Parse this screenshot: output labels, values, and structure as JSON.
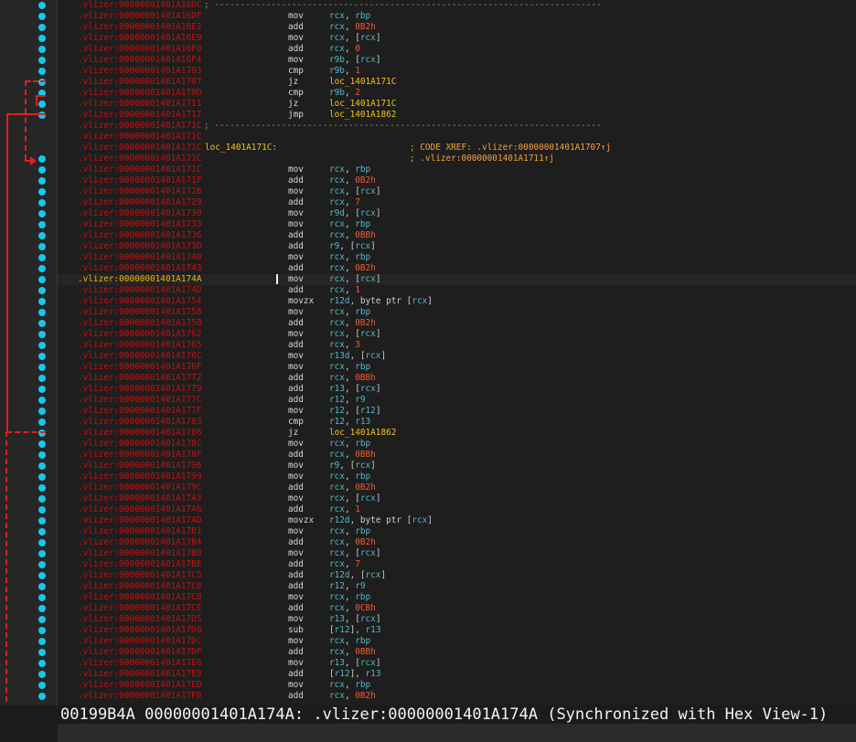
{
  "status_bar": {
    "text": "00199B4A 00000001401A174A: .vlizer:00000001401A174A (Synchronized with Hex View-1)"
  },
  "colors": {
    "background": "#1e1e1e",
    "address_red": "#c31111",
    "address_selected": "#f3b400",
    "register": "#56b7c8",
    "number": "#ef5b36",
    "label": "#f3c219",
    "comment": "#f7a23a",
    "flow_arrow": "#e0201e",
    "gutter_dot": "#18c6ee"
  },
  "listing": {
    "selected_address": ".vlizer:00000001401A174A",
    "rows": [
      {
        "addr": ".vlizer:00000001401A16DC",
        "sep": "; ---------------------------------------------------------------------------"
      },
      {
        "addr": ".vlizer:00000001401A16DF",
        "mn": "mov",
        "ops": [
          [
            "reg",
            "rcx"
          ],
          [
            "txt",
            ", "
          ],
          [
            "reg",
            "rbp"
          ]
        ]
      },
      {
        "addr": ".vlizer:00000001401A16E2",
        "mn": "add",
        "ops": [
          [
            "reg",
            "rcx"
          ],
          [
            "txt",
            ", "
          ],
          [
            "num",
            "0B2h"
          ]
        ]
      },
      {
        "addr": ".vlizer:00000001401A16E9",
        "mn": "mov",
        "ops": [
          [
            "reg",
            "rcx"
          ],
          [
            "txt",
            ", ["
          ],
          [
            "reg",
            "rcx"
          ],
          [
            "txt",
            "]"
          ]
        ]
      },
      {
        "addr": ".vlizer:00000001401A16F0",
        "mn": "add",
        "ops": [
          [
            "reg",
            "rcx"
          ],
          [
            "txt",
            ", "
          ],
          [
            "num",
            "0"
          ]
        ]
      },
      {
        "addr": ".vlizer:00000001401A16F4",
        "mn": "mov",
        "ops": [
          [
            "reg",
            "r9b"
          ],
          [
            "txt",
            ", ["
          ],
          [
            "reg",
            "rcx"
          ],
          [
            "txt",
            "]"
          ]
        ]
      },
      {
        "addr": ".vlizer:00000001401A1703",
        "mn": "cmp",
        "ops": [
          [
            "reg",
            "r9b"
          ],
          [
            "txt",
            ", "
          ],
          [
            "num",
            "1"
          ]
        ]
      },
      {
        "addr": ".vlizer:00000001401A1707",
        "mn": "jz",
        "ops": [
          [
            "loc",
            "loc_1401A171C"
          ]
        ]
      },
      {
        "addr": ".vlizer:00000001401A170D",
        "mn": "cmp",
        "ops": [
          [
            "reg",
            "r9b"
          ],
          [
            "txt",
            ", "
          ],
          [
            "num",
            "2"
          ]
        ]
      },
      {
        "addr": ".vlizer:00000001401A1711",
        "mn": "jz",
        "ops": [
          [
            "loc",
            "loc_1401A171C"
          ]
        ]
      },
      {
        "addr": ".vlizer:00000001401A1717",
        "mn": "jmp",
        "ops": [
          [
            "loc",
            "loc_1401A1862"
          ]
        ]
      },
      {
        "addr": ".vlizer:00000001401A171C",
        "sep": "; ---------------------------------------------------------------------------"
      },
      {
        "addr": ".vlizer:00000001401A171C"
      },
      {
        "addr": ".vlizer:00000001401A171C",
        "label": "loc_1401A171C:",
        "xref": "; CODE XREF: .vlizer:00000001401A1707↑j"
      },
      {
        "addr": ".vlizer:00000001401A171C",
        "xref": "; .vlizer:00000001401A1711↑j"
      },
      {
        "addr": ".vlizer:00000001401A171C",
        "mn": "mov",
        "ops": [
          [
            "reg",
            "rcx"
          ],
          [
            "txt",
            ", "
          ],
          [
            "reg",
            "rbp"
          ]
        ]
      },
      {
        "addr": ".vlizer:00000001401A171F",
        "mn": "add",
        "ops": [
          [
            "reg",
            "rcx"
          ],
          [
            "txt",
            ", "
          ],
          [
            "num",
            "0B2h"
          ]
        ]
      },
      {
        "addr": ".vlizer:00000001401A1726",
        "mn": "mov",
        "ops": [
          [
            "reg",
            "rcx"
          ],
          [
            "txt",
            ", ["
          ],
          [
            "reg",
            "rcx"
          ],
          [
            "txt",
            "]"
          ]
        ]
      },
      {
        "addr": ".vlizer:00000001401A1729",
        "mn": "add",
        "ops": [
          [
            "reg",
            "rcx"
          ],
          [
            "txt",
            ", "
          ],
          [
            "num",
            "7"
          ]
        ]
      },
      {
        "addr": ".vlizer:00000001401A1730",
        "mn": "mov",
        "ops": [
          [
            "reg",
            "r9d"
          ],
          [
            "txt",
            ", ["
          ],
          [
            "reg",
            "rcx"
          ],
          [
            "txt",
            "]"
          ]
        ]
      },
      {
        "addr": ".vlizer:00000001401A1733",
        "mn": "mov",
        "ops": [
          [
            "reg",
            "rcx"
          ],
          [
            "txt",
            ", "
          ],
          [
            "reg",
            "rbp"
          ]
        ]
      },
      {
        "addr": ".vlizer:00000001401A1736",
        "mn": "add",
        "ops": [
          [
            "reg",
            "rcx"
          ],
          [
            "txt",
            ", "
          ],
          [
            "num",
            "0BBh"
          ]
        ]
      },
      {
        "addr": ".vlizer:00000001401A173D",
        "mn": "add",
        "ops": [
          [
            "reg",
            "r9"
          ],
          [
            "txt",
            ", ["
          ],
          [
            "reg",
            "rcx"
          ],
          [
            "txt",
            "]"
          ]
        ]
      },
      {
        "addr": ".vlizer:00000001401A1740",
        "mn": "mov",
        "ops": [
          [
            "reg",
            "rcx"
          ],
          [
            "txt",
            ", "
          ],
          [
            "reg",
            "rbp"
          ]
        ]
      },
      {
        "addr": ".vlizer:00000001401A1743",
        "mn": "add",
        "ops": [
          [
            "reg",
            "rcx"
          ],
          [
            "txt",
            ", "
          ],
          [
            "num",
            "0B2h"
          ]
        ]
      },
      {
        "addr": ".vlizer:00000001401A174A",
        "mn": "mov",
        "ops": [
          [
            "reg",
            "rcx"
          ],
          [
            "txt",
            ", ["
          ],
          [
            "reg",
            "rcx"
          ],
          [
            "txt",
            "]"
          ]
        ],
        "selected": true
      },
      {
        "addr": ".vlizer:00000001401A174D",
        "mn": "add",
        "ops": [
          [
            "reg",
            "rcx"
          ],
          [
            "txt",
            ", "
          ],
          [
            "num",
            "1"
          ]
        ]
      },
      {
        "addr": ".vlizer:00000001401A1754",
        "mn": "movzx",
        "ops": [
          [
            "reg",
            "r12d"
          ],
          [
            "txt",
            ", byte ptr ["
          ],
          [
            "reg",
            "rcx"
          ],
          [
            "txt",
            "]"
          ]
        ]
      },
      {
        "addr": ".vlizer:00000001401A1758",
        "mn": "mov",
        "ops": [
          [
            "reg",
            "rcx"
          ],
          [
            "txt",
            ", "
          ],
          [
            "reg",
            "rbp"
          ]
        ]
      },
      {
        "addr": ".vlizer:00000001401A175B",
        "mn": "add",
        "ops": [
          [
            "reg",
            "rcx"
          ],
          [
            "txt",
            ", "
          ],
          [
            "num",
            "0B2h"
          ]
        ]
      },
      {
        "addr": ".vlizer:00000001401A1762",
        "mn": "mov",
        "ops": [
          [
            "reg",
            "rcx"
          ],
          [
            "txt",
            ", ["
          ],
          [
            "reg",
            "rcx"
          ],
          [
            "txt",
            "]"
          ]
        ]
      },
      {
        "addr": ".vlizer:00000001401A1765",
        "mn": "add",
        "ops": [
          [
            "reg",
            "rcx"
          ],
          [
            "txt",
            ", "
          ],
          [
            "num",
            "3"
          ]
        ]
      },
      {
        "addr": ".vlizer:00000001401A176C",
        "mn": "mov",
        "ops": [
          [
            "reg",
            "r13d"
          ],
          [
            "txt",
            ", ["
          ],
          [
            "reg",
            "rcx"
          ],
          [
            "txt",
            "]"
          ]
        ]
      },
      {
        "addr": ".vlizer:00000001401A176F",
        "mn": "mov",
        "ops": [
          [
            "reg",
            "rcx"
          ],
          [
            "txt",
            ", "
          ],
          [
            "reg",
            "rbp"
          ]
        ]
      },
      {
        "addr": ".vlizer:00000001401A1772",
        "mn": "add",
        "ops": [
          [
            "reg",
            "rcx"
          ],
          [
            "txt",
            ", "
          ],
          [
            "num",
            "0BBh"
          ]
        ]
      },
      {
        "addr": ".vlizer:00000001401A1779",
        "mn": "add",
        "ops": [
          [
            "reg",
            "r13"
          ],
          [
            "txt",
            ", ["
          ],
          [
            "reg",
            "rcx"
          ],
          [
            "txt",
            "]"
          ]
        ]
      },
      {
        "addr": ".vlizer:00000001401A177C",
        "mn": "add",
        "ops": [
          [
            "reg",
            "r12"
          ],
          [
            "txt",
            ", "
          ],
          [
            "reg",
            "r9"
          ]
        ]
      },
      {
        "addr": ".vlizer:00000001401A177F",
        "mn": "mov",
        "ops": [
          [
            "reg",
            "r12"
          ],
          [
            "txt",
            ", ["
          ],
          [
            "reg",
            "r12"
          ],
          [
            "txt",
            "]"
          ]
        ]
      },
      {
        "addr": ".vlizer:00000001401A1783",
        "mn": "cmp",
        "ops": [
          [
            "reg",
            "r12"
          ],
          [
            "txt",
            ", "
          ],
          [
            "reg",
            "r13"
          ]
        ]
      },
      {
        "addr": ".vlizer:00000001401A1786",
        "mn": "jz",
        "ops": [
          [
            "loc",
            "loc_1401A1862"
          ]
        ]
      },
      {
        "addr": ".vlizer:00000001401A178C",
        "mn": "mov",
        "ops": [
          [
            "reg",
            "rcx"
          ],
          [
            "txt",
            ", "
          ],
          [
            "reg",
            "rbp"
          ]
        ]
      },
      {
        "addr": ".vlizer:00000001401A178F",
        "mn": "add",
        "ops": [
          [
            "reg",
            "rcx"
          ],
          [
            "txt",
            ", "
          ],
          [
            "num",
            "0BBh"
          ]
        ]
      },
      {
        "addr": ".vlizer:00000001401A1796",
        "mn": "mov",
        "ops": [
          [
            "reg",
            "r9"
          ],
          [
            "txt",
            ", ["
          ],
          [
            "reg",
            "rcx"
          ],
          [
            "txt",
            "]"
          ]
        ]
      },
      {
        "addr": ".vlizer:00000001401A1799",
        "mn": "mov",
        "ops": [
          [
            "reg",
            "rcx"
          ],
          [
            "txt",
            ", "
          ],
          [
            "reg",
            "rbp"
          ]
        ]
      },
      {
        "addr": ".vlizer:00000001401A179C",
        "mn": "add",
        "ops": [
          [
            "reg",
            "rcx"
          ],
          [
            "txt",
            ", "
          ],
          [
            "num",
            "0B2h"
          ]
        ]
      },
      {
        "addr": ".vlizer:00000001401A17A3",
        "mn": "mov",
        "ops": [
          [
            "reg",
            "rcx"
          ],
          [
            "txt",
            ", ["
          ],
          [
            "reg",
            "rcx"
          ],
          [
            "txt",
            "]"
          ]
        ]
      },
      {
        "addr": ".vlizer:00000001401A17A6",
        "mn": "add",
        "ops": [
          [
            "reg",
            "rcx"
          ],
          [
            "txt",
            ", "
          ],
          [
            "num",
            "1"
          ]
        ]
      },
      {
        "addr": ".vlizer:00000001401A17AD",
        "mn": "movzx",
        "ops": [
          [
            "reg",
            "r12d"
          ],
          [
            "txt",
            ", byte ptr ["
          ],
          [
            "reg",
            "rcx"
          ],
          [
            "txt",
            "]"
          ]
        ]
      },
      {
        "addr": ".vlizer:00000001401A17B1",
        "mn": "mov",
        "ops": [
          [
            "reg",
            "rcx"
          ],
          [
            "txt",
            ", "
          ],
          [
            "reg",
            "rbp"
          ]
        ]
      },
      {
        "addr": ".vlizer:00000001401A17B4",
        "mn": "add",
        "ops": [
          [
            "reg",
            "rcx"
          ],
          [
            "txt",
            ", "
          ],
          [
            "num",
            "0B2h"
          ]
        ]
      },
      {
        "addr": ".vlizer:00000001401A17BB",
        "mn": "mov",
        "ops": [
          [
            "reg",
            "rcx"
          ],
          [
            "txt",
            ", ["
          ],
          [
            "reg",
            "rcx"
          ],
          [
            "txt",
            "]"
          ]
        ]
      },
      {
        "addr": ".vlizer:00000001401A17BE",
        "mn": "add",
        "ops": [
          [
            "reg",
            "rcx"
          ],
          [
            "txt",
            ", "
          ],
          [
            "num",
            "7"
          ]
        ]
      },
      {
        "addr": ".vlizer:00000001401A17C5",
        "mn": "add",
        "ops": [
          [
            "reg",
            "r12d"
          ],
          [
            "txt",
            ", ["
          ],
          [
            "reg",
            "rcx"
          ],
          [
            "txt",
            "]"
          ]
        ]
      },
      {
        "addr": ".vlizer:00000001401A17C8",
        "mn": "add",
        "ops": [
          [
            "reg",
            "r12"
          ],
          [
            "txt",
            ", "
          ],
          [
            "reg",
            "r9"
          ]
        ]
      },
      {
        "addr": ".vlizer:00000001401A17CB",
        "mn": "mov",
        "ops": [
          [
            "reg",
            "rcx"
          ],
          [
            "txt",
            ", "
          ],
          [
            "reg",
            "rbp"
          ]
        ]
      },
      {
        "addr": ".vlizer:00000001401A17CE",
        "mn": "add",
        "ops": [
          [
            "reg",
            "rcx"
          ],
          [
            "txt",
            ", "
          ],
          [
            "num",
            "0CBh"
          ]
        ]
      },
      {
        "addr": ".vlizer:00000001401A17D5",
        "mn": "mov",
        "ops": [
          [
            "reg",
            "r13"
          ],
          [
            "txt",
            ", ["
          ],
          [
            "reg",
            "rcx"
          ],
          [
            "txt",
            "]"
          ]
        ]
      },
      {
        "addr": ".vlizer:00000001401A17D8",
        "mn": "sub",
        "ops": [
          [
            "txt",
            "["
          ],
          [
            "reg",
            "r12"
          ],
          [
            "txt",
            "], "
          ],
          [
            "reg",
            "r13"
          ]
        ]
      },
      {
        "addr": ".vlizer:00000001401A17DC",
        "mn": "mov",
        "ops": [
          [
            "reg",
            "rcx"
          ],
          [
            "txt",
            ", "
          ],
          [
            "reg",
            "rbp"
          ]
        ]
      },
      {
        "addr": ".vlizer:00000001401A17DF",
        "mn": "add",
        "ops": [
          [
            "reg",
            "rcx"
          ],
          [
            "txt",
            ", "
          ],
          [
            "num",
            "0BBh"
          ]
        ]
      },
      {
        "addr": ".vlizer:00000001401A17E6",
        "mn": "mov",
        "ops": [
          [
            "reg",
            "r13"
          ],
          [
            "txt",
            ", ["
          ],
          [
            "reg",
            "rcx"
          ],
          [
            "txt",
            "]"
          ]
        ]
      },
      {
        "addr": ".vlizer:00000001401A17E9",
        "mn": "add",
        "ops": [
          [
            "txt",
            "["
          ],
          [
            "reg",
            "r12"
          ],
          [
            "txt",
            "], "
          ],
          [
            "reg",
            "r13"
          ]
        ]
      },
      {
        "addr": ".vlizer:00000001401A17ED",
        "mn": "mov",
        "ops": [
          [
            "reg",
            "rcx"
          ],
          [
            "txt",
            ", "
          ],
          [
            "reg",
            "rbp"
          ]
        ]
      },
      {
        "addr": ".vlizer:00000001401A17F0",
        "mn": "add",
        "ops": [
          [
            "reg",
            "rcx"
          ],
          [
            "txt",
            ", "
          ],
          [
            "num",
            "0B2h"
          ]
        ]
      }
    ]
  }
}
